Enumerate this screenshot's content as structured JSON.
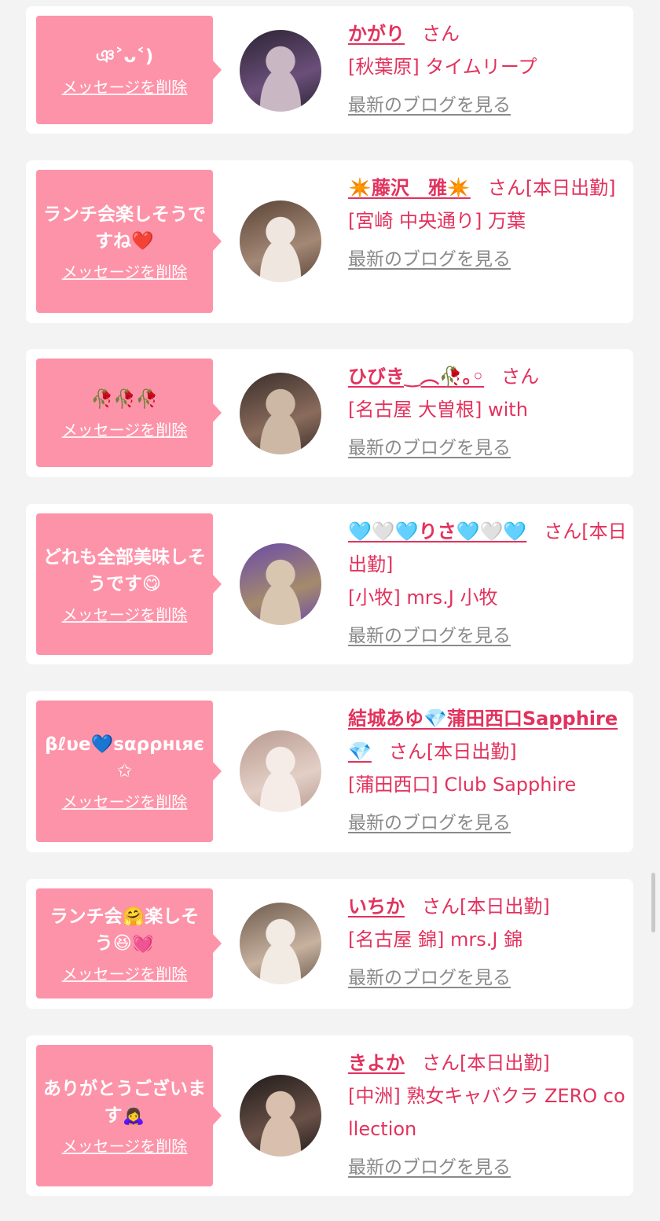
{
  "delete_label": "メッセージを削除",
  "san_label": "さん",
  "blog_label": "最新のブログを見る",
  "colors": {
    "background": "#f3f3f3",
    "bubble": "#fd93a9",
    "accent": "#e2325d",
    "link_gray": "#8a8a8a"
  },
  "cards": [
    {
      "message": "ঞ˃ᴗ˂)",
      "name": "かがり",
      "status": "",
      "shop": "[秋葉原] タイムリープ",
      "avatar_colors": [
        "#2b2333",
        "#6b4f7a",
        "#c9b7c4"
      ]
    },
    {
      "message": "ランチ会楽しそうですね❤️",
      "name": "✴️藤沢　雅✴️",
      "status": "[本日出勤]",
      "shop": "[宮崎 中央通り] 万葉",
      "avatar_colors": [
        "#5a4436",
        "#a48876",
        "#efe6df"
      ]
    },
    {
      "message": "🥀🥀🥀",
      "name": "ひびき‿︵🥀｡◦",
      "status": "",
      "shop": "[名古屋 大曽根] with",
      "avatar_colors": [
        "#3a2e2a",
        "#8a6c5c",
        "#cdb8a6"
      ]
    },
    {
      "message": "どれも全部美味しそうです😋",
      "name": "🩵🤍🩵りさ🩵🤍🩵",
      "status": "[本日出勤]",
      "shop": "[小牧] mrs.J 小牧",
      "avatar_colors": [
        "#6a4aa8",
        "#a58b6c",
        "#d8c6b0"
      ]
    },
    {
      "message": "βℓυе💙ѕαρρнιяє✩",
      "name": "結城あゆ💎蒲田西口Sapphire💎",
      "status": "[本日出勤]",
      "shop": "[蒲田西口] Club Sapphire",
      "avatar_colors": [
        "#b89a90",
        "#e3cfc6",
        "#f5ece8"
      ]
    },
    {
      "message": "ランチ会🤗楽しそう😆💓",
      "name": "いちか",
      "status": "[本日出勤]",
      "shop": "[名古屋 錦] mrs.J 錦",
      "avatar_colors": [
        "#6e5a4c",
        "#c7b2a0",
        "#f1ebe4"
      ]
    },
    {
      "message": "ありがとうございます🙇‍♀️",
      "name": "きよか",
      "status": "[本日出勤]",
      "shop": "[中洲] 熟女キャバクラ ZERO collection",
      "avatar_colors": [
        "#1f1b1a",
        "#6a5148",
        "#d9bfae"
      ]
    }
  ]
}
